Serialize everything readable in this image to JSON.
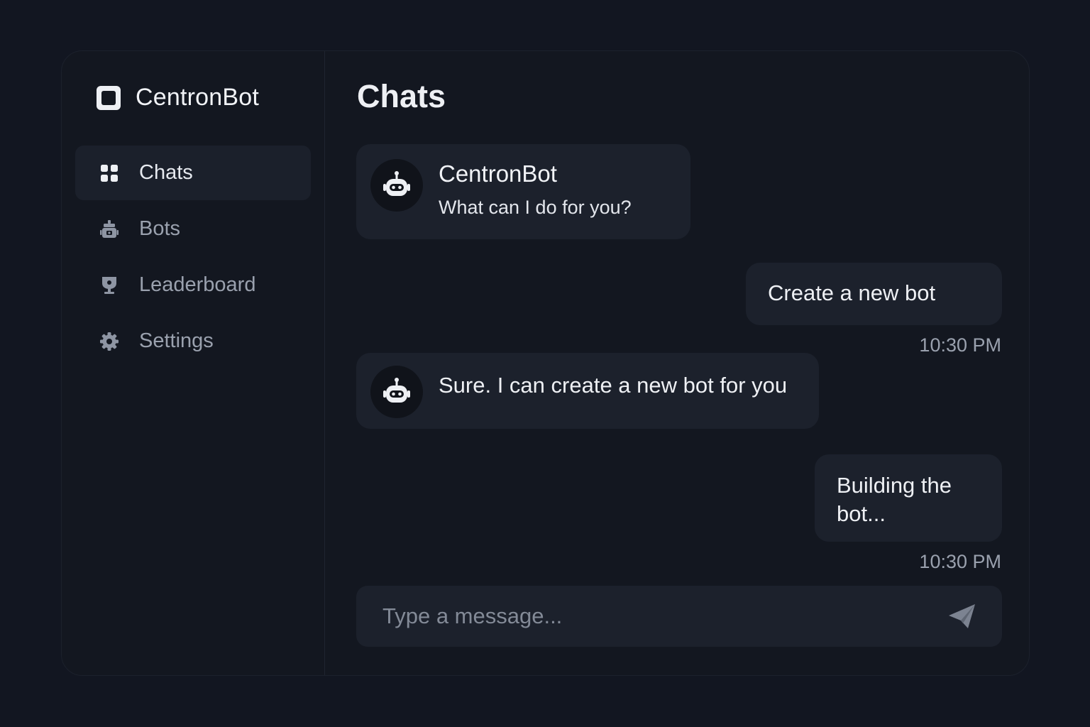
{
  "app": {
    "name": "CentronBot",
    "brand_icon": "square-logo-icon"
  },
  "sidebar": {
    "items": [
      {
        "label": "Chats",
        "icon": "grid-icon",
        "active": true
      },
      {
        "label": "Bots",
        "icon": "robot-icon",
        "active": false
      },
      {
        "label": "Leaderboard",
        "icon": "trophy-icon",
        "active": false
      },
      {
        "label": "Settings",
        "icon": "gear-icon",
        "active": false
      }
    ]
  },
  "main": {
    "title": "Chats",
    "messages": [
      {
        "from": "bot",
        "sender": "CentronBot",
        "text": "What can I do for you?",
        "avatar_icon": "robot-icon"
      },
      {
        "from": "user",
        "text": "Create a new bot",
        "time": "10:30 PM"
      },
      {
        "from": "bot",
        "text": "Sure. I can create a new bot for you",
        "avatar_icon": "robot-icon"
      },
      {
        "from": "user",
        "text": "Building the bot...",
        "time": "10:30 PM"
      }
    ]
  },
  "composer": {
    "placeholder": "Type a message...",
    "value": "",
    "send_icon": "send-icon"
  },
  "colors": {
    "background": "#121621",
    "panel": "#131720",
    "bubble": "#1c212c",
    "text_primary": "#eef0f4",
    "text_muted": "#9aa1ae"
  }
}
